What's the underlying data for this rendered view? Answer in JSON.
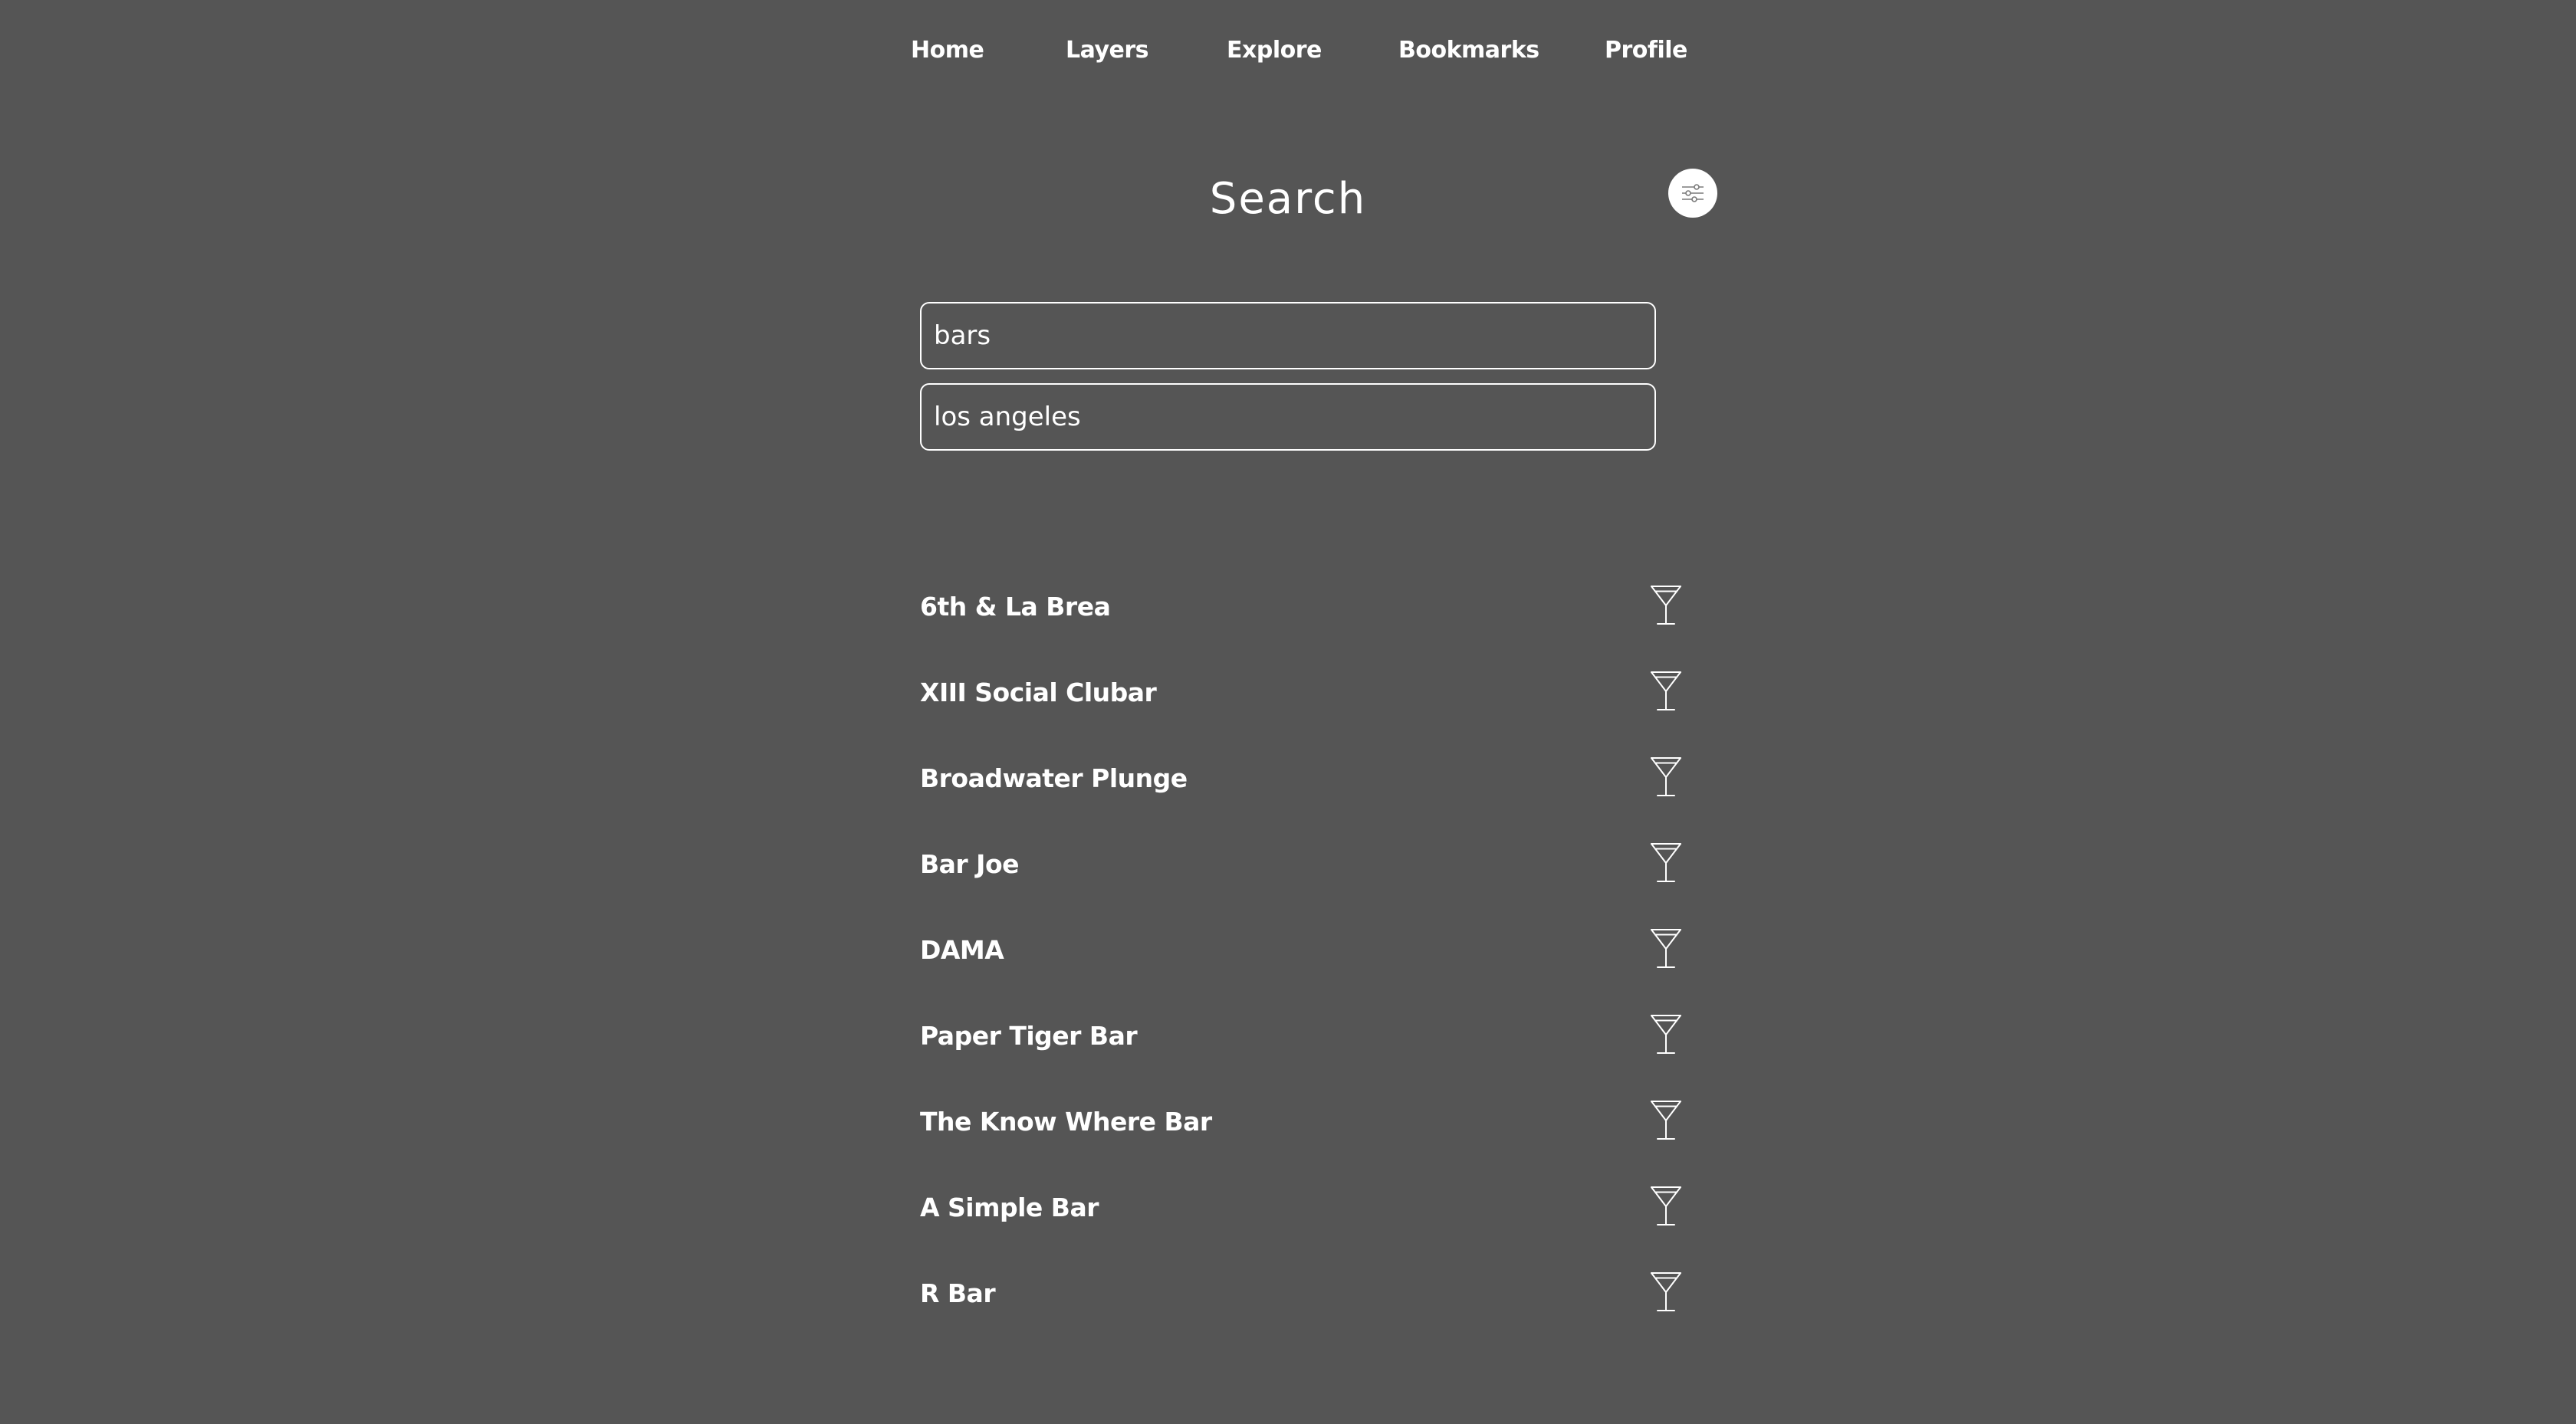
{
  "nav": {
    "items": [
      {
        "label": "Home"
      },
      {
        "label": "Layers"
      },
      {
        "label": "Explore"
      },
      {
        "label": "Bookmarks"
      },
      {
        "label": "Profile"
      }
    ]
  },
  "header": {
    "title": "Search",
    "filter_icon": "sliders-icon"
  },
  "search": {
    "what_value": "bars",
    "where_value": "los angeles"
  },
  "results": {
    "icon": "cocktail-glass-icon",
    "items": [
      {
        "name": "6th & La Brea"
      },
      {
        "name": "XIII Social Clubar"
      },
      {
        "name": "Broadwater Plunge"
      },
      {
        "name": "Bar Joe"
      },
      {
        "name": "DAMA"
      },
      {
        "name": "Paper Tiger Bar"
      },
      {
        "name": "The Know Where Bar"
      },
      {
        "name": "A Simple Bar"
      },
      {
        "name": "R Bar"
      }
    ]
  },
  "colors": {
    "background": "#555555",
    "foreground": "#ffffff"
  }
}
